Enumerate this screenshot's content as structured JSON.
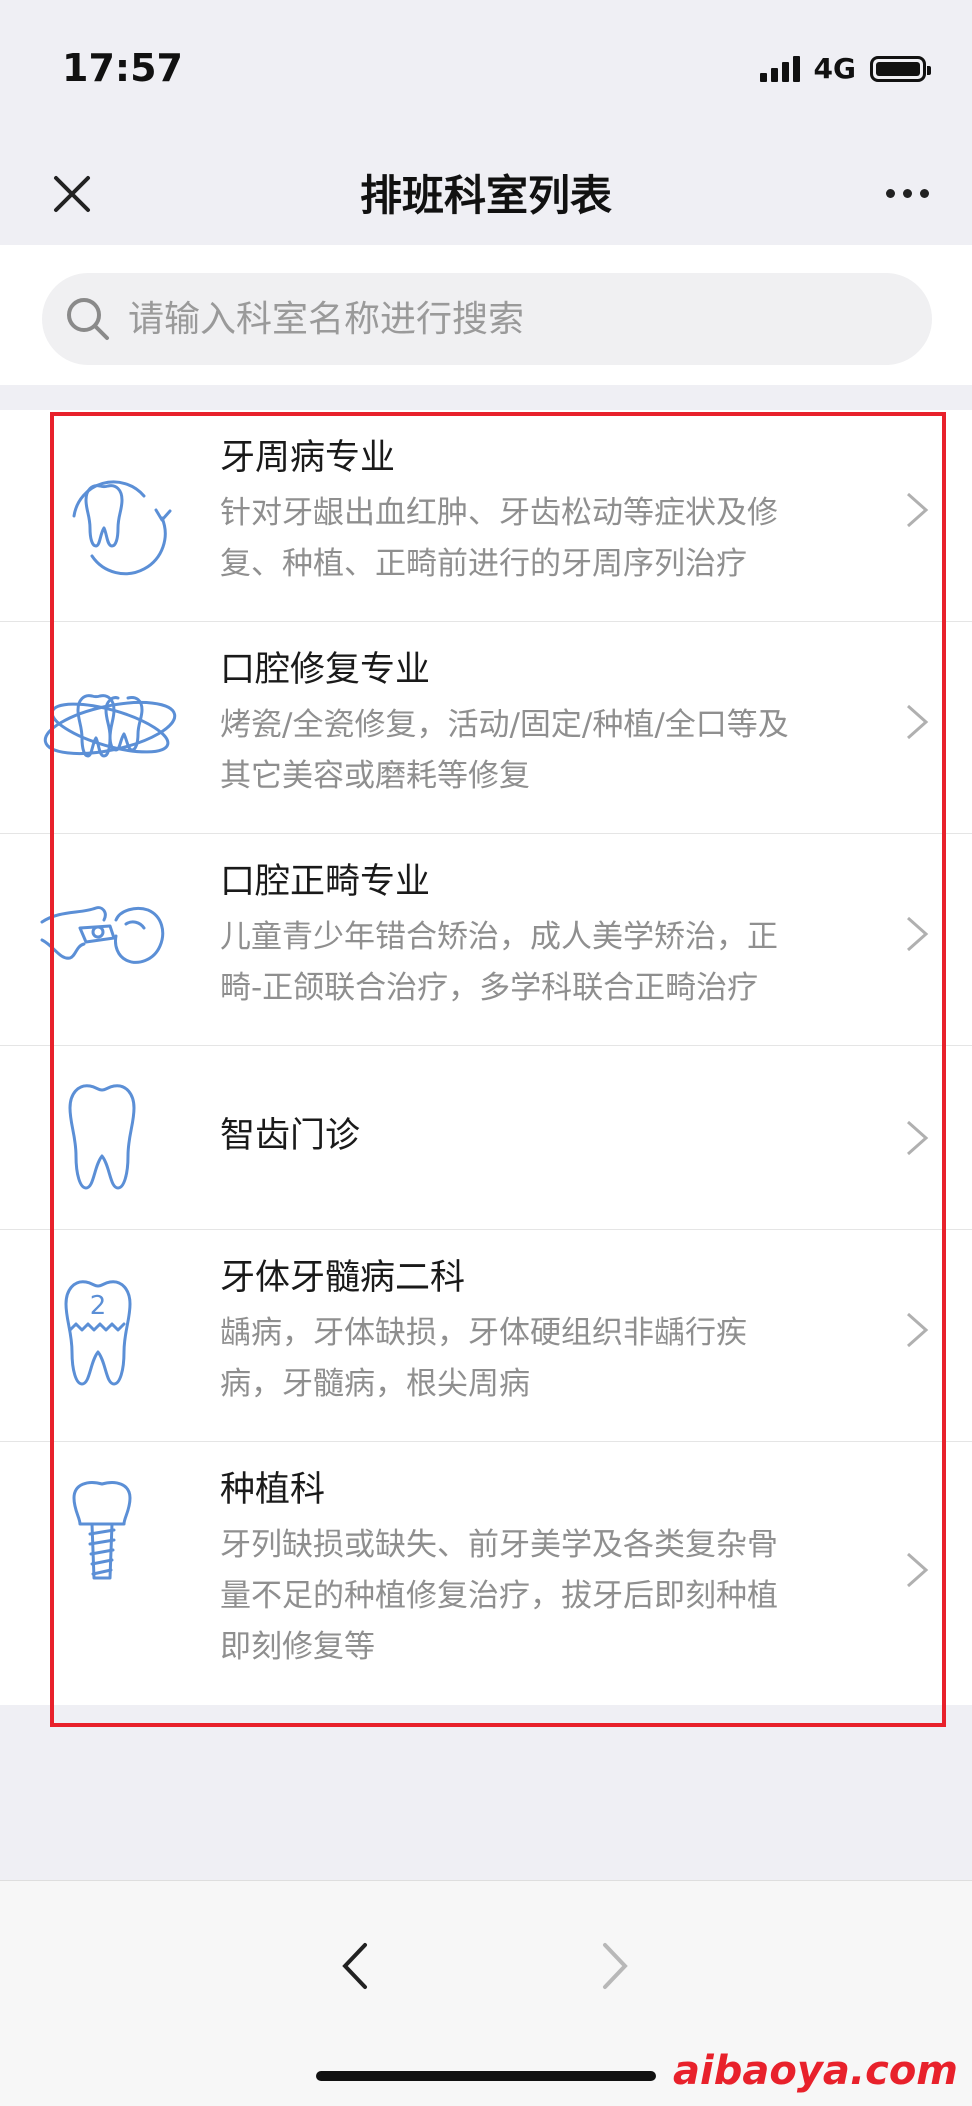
{
  "status": {
    "time": "17:57",
    "network": "4G"
  },
  "nav": {
    "title": "排班科室列表"
  },
  "search": {
    "placeholder": "请输入科室名称进行搜索"
  },
  "departments": [
    {
      "icon": "tooth-rotate-icon",
      "title": "牙周病专业",
      "desc": [
        "针对牙龈出血红肿、牙齿松动等症状及修",
        "复、种植、正畸前进行的牙周序列治疗"
      ]
    },
    {
      "icon": "tooth-orbit-icon",
      "title": "口腔修复专业",
      "desc": [
        "烤瓷/全瓷修复，活动/固定/种植/全口等及",
        "其它美容或磨耗等修复"
      ]
    },
    {
      "icon": "tooth-braces-icon",
      "title": "口腔正畸专业",
      "desc": [
        "儿童青少年错合矫治，成人美学矫治，正",
        "畸-正颌联合治疗，多学科联合正畸治疗"
      ]
    },
    {
      "icon": "wisdom-tooth-icon",
      "title": "智齿门诊",
      "desc": []
    },
    {
      "icon": "tooth-number-icon",
      "title": "牙体牙髓病二科",
      "desc": [
        "龋病，牙体缺损，牙体硬组织非龋行疾",
        "病，牙髓病，根尖周病"
      ]
    },
    {
      "icon": "tooth-implant-icon",
      "title": "种植科",
      "desc": [
        "牙列缺损或缺失、前牙美学及各类复杂骨",
        "量不足的种植修复治疗，拔牙后即刻种植",
        "即刻修复等"
      ]
    }
  ],
  "icon_labels": {
    "tooth_number": "2"
  },
  "watermark": "aibaoya.com",
  "colors": {
    "icon_blue": "#5b8fd6",
    "highlight_red": "#e8212b"
  }
}
